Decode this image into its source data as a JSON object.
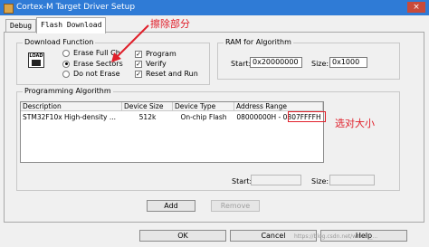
{
  "window": {
    "title": "Cortex-M Target Driver Setup",
    "close_symbol": "×"
  },
  "tabs": [
    {
      "label": "Debug"
    },
    {
      "label": "Flash Download"
    }
  ],
  "download_function": {
    "group_label": "Download Function",
    "icon_text": "LOAD",
    "options": [
      {
        "label": "Erase Full Ch",
        "selected": false
      },
      {
        "label": "Erase Sectors",
        "selected": true
      },
      {
        "label": "Do not Erase",
        "selected": false
      }
    ],
    "checks": [
      {
        "label": "Program",
        "checked": true
      },
      {
        "label": "Verify",
        "checked": true
      },
      {
        "label": "Reset and Run",
        "checked": true
      }
    ]
  },
  "ram_for_algorithm": {
    "group_label": "RAM for Algorithm",
    "start_label": "Start:",
    "start_value": "0x20000000",
    "size_label": "Size:",
    "size_value": "0x1000"
  },
  "programming_algorithm": {
    "group_label": "Programming Algorithm",
    "columns": [
      "Description",
      "Device Size",
      "Device Type",
      "Address Range"
    ],
    "rows": [
      {
        "description": "STM32F10x High-density ...",
        "device_size": "512k",
        "device_type": "On-chip Flash",
        "address_range": "08000000H - 0807FFFFH"
      }
    ],
    "start_label": "Start:",
    "size_label": "Size:",
    "add_label": "Add",
    "remove_label": "Remove"
  },
  "footer": {
    "ok_label": "OK",
    "cancel_label": "Cancel",
    "help_label": "Help"
  },
  "annotations": {
    "erase_note": "擦除部分",
    "size_note": "选对大小",
    "annotation_color": "#e0202b"
  },
  "watermark": "https://blog.csdn.net/weixin_..."
}
